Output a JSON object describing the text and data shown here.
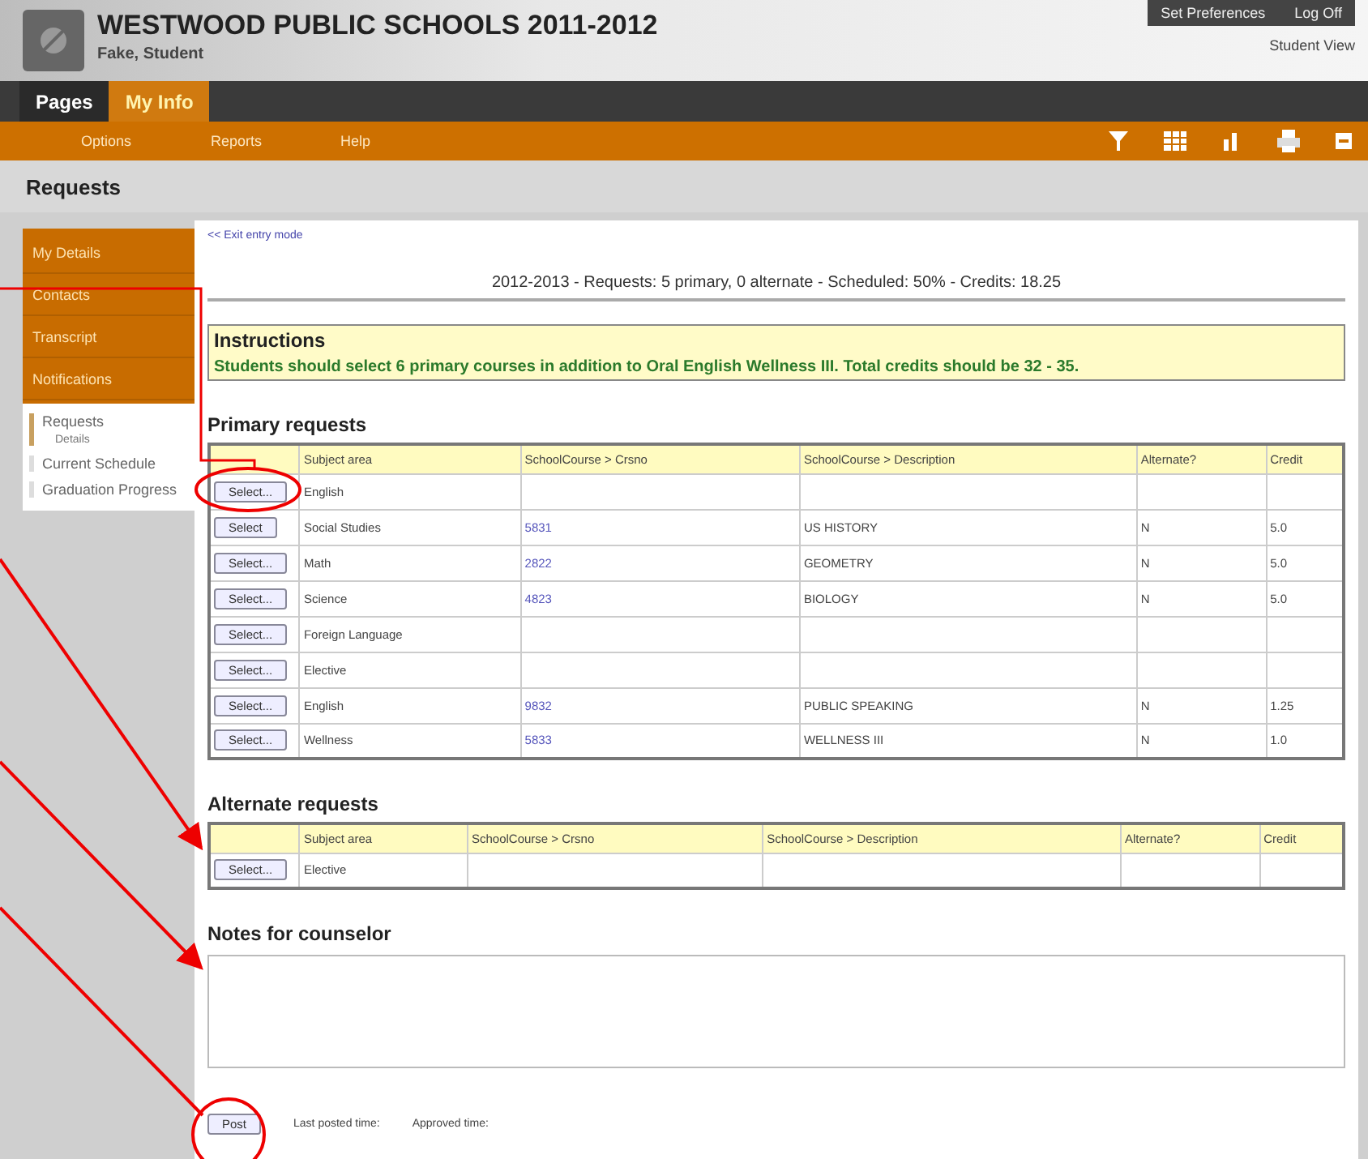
{
  "header": {
    "title": "WESTWOOD PUBLIC SCHOOLS 2011-2012",
    "user": "Fake, Student",
    "links": [
      "Set Preferences",
      "Log Off"
    ],
    "view": "Student View"
  },
  "tabs": [
    {
      "label": "Pages",
      "selected": false
    },
    {
      "label": "My Info",
      "selected": true
    }
  ],
  "menu": [
    "Options",
    "Reports",
    "Help"
  ],
  "page_title": "Requests",
  "sidebar": {
    "items": [
      {
        "label": "My Details",
        "kind": "main",
        "selected": false
      },
      {
        "label": "Contacts",
        "kind": "main",
        "selected": false
      },
      {
        "label": "Transcript",
        "kind": "main",
        "selected": false
      },
      {
        "label": "Notifications",
        "kind": "main",
        "selected": false
      },
      {
        "label": "Requests",
        "kind": "sub",
        "selected": true,
        "children": [
          {
            "label": "Details"
          }
        ]
      },
      {
        "label": "Current Schedule",
        "kind": "sub",
        "selected": false
      },
      {
        "label": "Graduation Progress",
        "kind": "sub",
        "selected": false
      }
    ]
  },
  "exit_link": "<< Exit entry mode",
  "summary": "2012-2013 - Requests: 5 primary, 0 alternate - Scheduled: 50% - Credits: 18.25",
  "instructions": {
    "title": "Instructions",
    "text": "Students should select 6 primary courses in addition to Oral English Wellness III. Total credits should be 32 - 35."
  },
  "primary": {
    "title": "Primary requests",
    "columns": [
      "Subject area",
      "SchoolCourse > Crsno",
      "SchoolCourse > Description",
      "Alternate?",
      "Credit"
    ],
    "rows": [
      {
        "button": "Select...",
        "subject": "English",
        "crsno": "",
        "description": "",
        "alternate": "",
        "credit": ""
      },
      {
        "button": "Select",
        "subject": "Social Studies",
        "crsno": "5831",
        "description": "US HISTORY",
        "alternate": "N",
        "credit": "5.0"
      },
      {
        "button": "Select...",
        "subject": "Math",
        "crsno": "2822",
        "description": "GEOMETRY",
        "alternate": "N",
        "credit": "5.0"
      },
      {
        "button": "Select...",
        "subject": "Science",
        "crsno": "4823",
        "description": "BIOLOGY",
        "alternate": "N",
        "credit": "5.0"
      },
      {
        "button": "Select...",
        "subject": "Foreign Language",
        "crsno": "",
        "description": "",
        "alternate": "",
        "credit": ""
      },
      {
        "button": "Select...",
        "subject": "Elective",
        "crsno": "",
        "description": "",
        "alternate": "",
        "credit": ""
      },
      {
        "button": "Select...",
        "subject": "English",
        "crsno": "9832",
        "description": "PUBLIC SPEAKING",
        "alternate": "N",
        "credit": "1.25"
      },
      {
        "button": "Select...",
        "subject": "Wellness",
        "crsno": "5833",
        "description": "WELLNESS III",
        "alternate": "N",
        "credit": "1.0"
      }
    ]
  },
  "alternate": {
    "title": "Alternate requests",
    "columns": [
      "Subject area",
      "SchoolCourse > Crsno",
      "SchoolCourse > Description",
      "Alternate?",
      "Credit"
    ],
    "rows": [
      {
        "button": "Select...",
        "subject": "Elective",
        "crsno": "",
        "description": "",
        "alternate": "",
        "credit": ""
      }
    ]
  },
  "notes": {
    "title": "Notes for counselor"
  },
  "footer": {
    "button": "Post",
    "labels": [
      "Last posted time:",
      "Approved time:"
    ]
  }
}
